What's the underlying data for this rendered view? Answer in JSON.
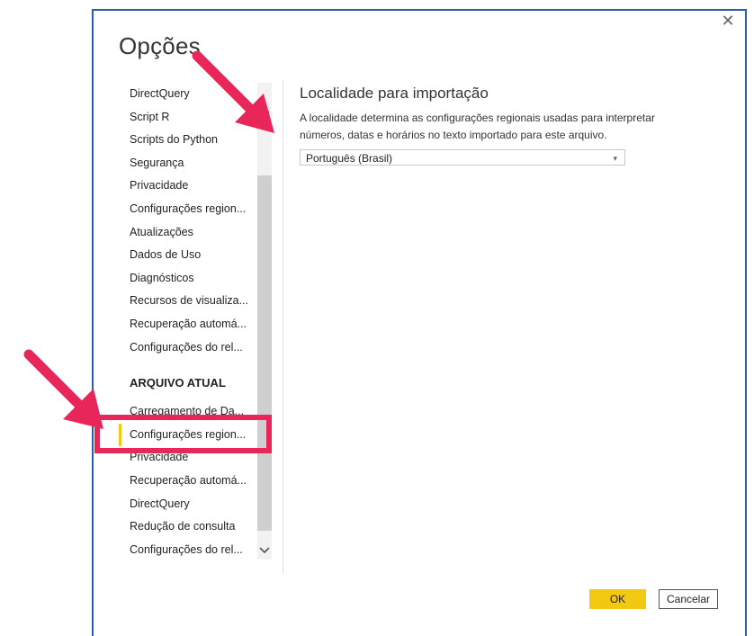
{
  "dialog": {
    "title": "Opções",
    "close_glyph": "✕"
  },
  "nav": {
    "items_global": [
      {
        "label": "DirectQuery"
      },
      {
        "label": "Script R"
      },
      {
        "label": "Scripts do Python"
      },
      {
        "label": "Segurança"
      },
      {
        "label": "Privacidade"
      },
      {
        "label": "Configurações region..."
      },
      {
        "label": "Atualizações"
      },
      {
        "label": "Dados de Uso"
      },
      {
        "label": "Diagnósticos"
      },
      {
        "label": "Recursos de visualiza..."
      },
      {
        "label": "Recuperação automá..."
      },
      {
        "label": "Configurações do rel..."
      }
    ],
    "section_current": "ARQUIVO ATUAL",
    "items_current": [
      {
        "label": "Carregamento de Da..."
      },
      {
        "label": "Configurações region...",
        "selected": true
      },
      {
        "label": "Privacidade"
      },
      {
        "label": "Recuperação automá..."
      },
      {
        "label": "DirectQuery"
      },
      {
        "label": "Redução de consulta"
      },
      {
        "label": "Configurações do rel..."
      }
    ]
  },
  "content": {
    "heading": "Localidade para importação",
    "description_line1": "A localidade determina as configurações regionais usadas para interpretar",
    "description_line2": "números, datas e horários no texto importado para este arquivo.",
    "locale_select_value": "Português (Brasil)",
    "locale_select_icon": "chevron-down-icon"
  },
  "buttons": {
    "ok": "OK",
    "cancel": "Cancelar"
  },
  "colors": {
    "accent": "#f2c811",
    "annotation": "#e8265a",
    "border": "#2a5fa8"
  }
}
